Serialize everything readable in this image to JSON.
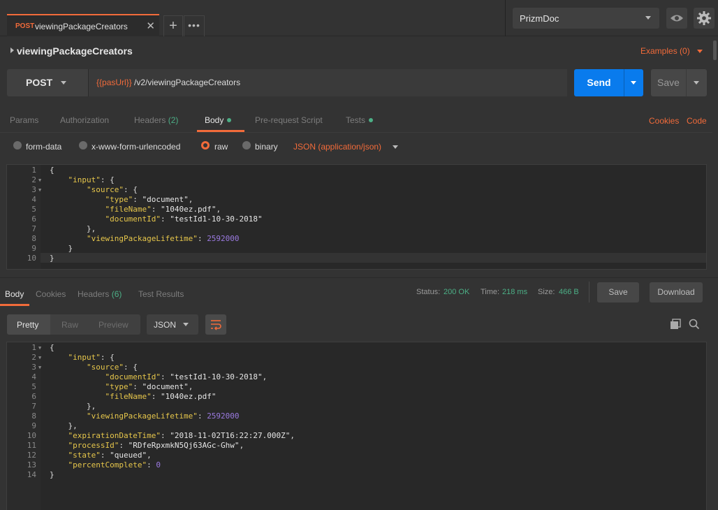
{
  "tab": {
    "method": "POST",
    "name": "viewingPackageCreators"
  },
  "environment": "PrizmDoc",
  "request": {
    "name": "viewingPackageCreators",
    "examples": "Examples (0)",
    "method": "POST",
    "url_var": "{{pasUrl}}",
    "url_path": "/v2/viewingPackageCreators",
    "send": "Send",
    "save": "Save"
  },
  "request_tabs": {
    "params": "Params",
    "authorization": "Authorization",
    "headers": "Headers",
    "headers_count": "(2)",
    "body": "Body",
    "prerequest": "Pre-request Script",
    "tests": "Tests",
    "cookies": "Cookies",
    "code": "Code"
  },
  "body_types": {
    "form_data": "form-data",
    "urlencoded": "x-www-form-urlencoded",
    "raw": "raw",
    "binary": "binary",
    "content_type": "JSON (application/json)"
  },
  "request_body": [
    [
      "{"
    ],
    [
      "    ",
      [
        "k",
        "\"input\""
      ],
      ": {"
    ],
    [
      "        ",
      [
        "k",
        "\"source\""
      ],
      ": {"
    ],
    [
      "            ",
      [
        "k",
        "\"type\""
      ],
      ": ",
      [
        "s",
        "\"document\""
      ],
      ","
    ],
    [
      "            ",
      [
        "k",
        "\"fileName\""
      ],
      ": ",
      [
        "s",
        "\"1040ez.pdf\""
      ],
      ","
    ],
    [
      "            ",
      [
        "k",
        "\"documentId\""
      ],
      ": ",
      [
        "s",
        "\"testId1-10-30-2018\""
      ]
    ],
    [
      "        },"
    ],
    [
      "        ",
      [
        "k",
        "\"viewingPackageLifetime\""
      ],
      ": ",
      [
        "n",
        "2592000"
      ]
    ],
    [
      "    }"
    ],
    [
      "}"
    ]
  ],
  "response_tabs": {
    "body": "Body",
    "cookies": "Cookies",
    "headers": "Headers",
    "headers_count": "(6)",
    "test_results": "Test Results"
  },
  "response_meta": {
    "status_label": "Status:",
    "status_value": "200 OK",
    "time_label": "Time:",
    "time_value": "218 ms",
    "size_label": "Size:",
    "size_value": "466 B",
    "save": "Save",
    "download": "Download"
  },
  "response_view": {
    "pretty": "Pretty",
    "raw": "Raw",
    "preview": "Preview",
    "format": "JSON"
  },
  "response_body": [
    [
      "{"
    ],
    [
      "    ",
      [
        "k",
        "\"input\""
      ],
      ": {"
    ],
    [
      "        ",
      [
        "k",
        "\"source\""
      ],
      ": {"
    ],
    [
      "            ",
      [
        "k",
        "\"documentId\""
      ],
      ": ",
      [
        "s",
        "\"testId1-10-30-2018\""
      ],
      ","
    ],
    [
      "            ",
      [
        "k",
        "\"type\""
      ],
      ": ",
      [
        "s",
        "\"document\""
      ],
      ","
    ],
    [
      "            ",
      [
        "k",
        "\"fileName\""
      ],
      ": ",
      [
        "s",
        "\"1040ez.pdf\""
      ]
    ],
    [
      "        },"
    ],
    [
      "        ",
      [
        "k",
        "\"viewingPackageLifetime\""
      ],
      ": ",
      [
        "n",
        "2592000"
      ]
    ],
    [
      "    },"
    ],
    [
      "    ",
      [
        "k",
        "\"expirationDateTime\""
      ],
      ": ",
      [
        "s",
        "\"2018-11-02T16:22:27.000Z\""
      ],
      ","
    ],
    [
      "    ",
      [
        "k",
        "\"processId\""
      ],
      ": ",
      [
        "s",
        "\"RDfeRpxmkN5Qj63AGc-Ghw\""
      ],
      ","
    ],
    [
      "    ",
      [
        "k",
        "\"state\""
      ],
      ": ",
      [
        "s",
        "\"queued\""
      ],
      ","
    ],
    [
      "    ",
      [
        "k",
        "\"percentComplete\""
      ],
      ": ",
      [
        "n",
        "0"
      ]
    ],
    [
      "}"
    ]
  ]
}
